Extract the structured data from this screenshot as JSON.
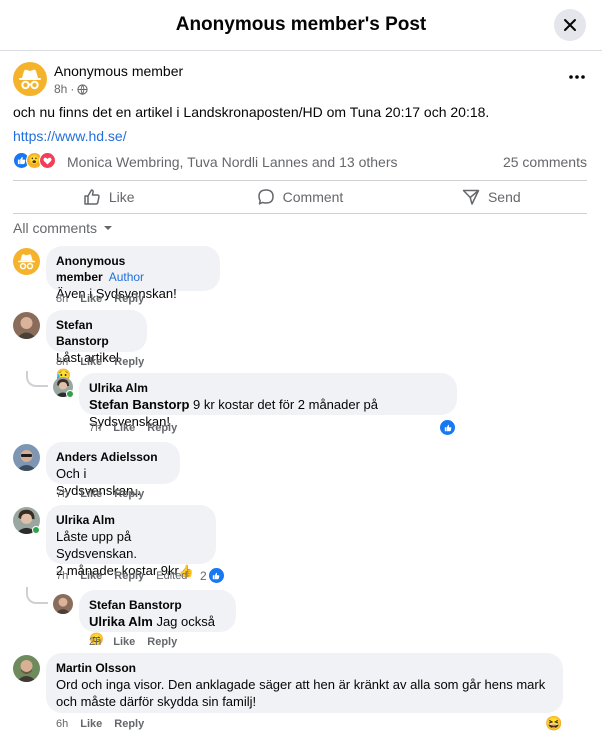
{
  "header": {
    "title": "Anonymous member's Post"
  },
  "post": {
    "author": "Anonymous member",
    "time": "8h",
    "text": "och nu finns det en artikel i Landskronaposten/HD om Tuna 20:17 och 20:18.",
    "link": "https://www.hd.se/",
    "reactions_text": "Monica Wembring, Tuva Nordli Lannes and 13 others",
    "comments_count": "25 comments"
  },
  "actions": {
    "like": "Like",
    "comment": "Comment",
    "send": "Send"
  },
  "filter": {
    "label": "All comments"
  },
  "comments": [
    {
      "name": "Anonymous member",
      "badge": "Author",
      "text": "Även i Sydsvenskan!",
      "time": "8h",
      "like": "Like",
      "reply": "Reply"
    },
    {
      "name": "Stefan Banstorp",
      "text": "Låst artikel",
      "emoji": "😥",
      "time": "8h",
      "like": "Like",
      "reply": "Reply"
    },
    {
      "name": "Ulrika Alm",
      "mention": "Stefan Banstorp",
      "text": " 9 kr kostar det för 2 månader på Sydsvenskan!",
      "time": "7h",
      "like": "Like",
      "reply": "Reply"
    },
    {
      "name": "Anders Adielsson",
      "text": "Och i Sydsvenskan...",
      "time": "7h",
      "like": "Like",
      "reply": "Reply"
    },
    {
      "name": "Ulrika Alm",
      "text1": "Låste upp på Sydsvenskan.",
      "text2": "2 månader kostar 9kr",
      "emoji": "👍",
      "time": "7h",
      "like": "Like",
      "reply": "Reply",
      "edited": "Edited",
      "reaction_count": "2"
    },
    {
      "name": "Stefan Banstorp",
      "mention": "Ulrika Alm",
      "text": " Jag också",
      "emoji": "😊",
      "time": "2h",
      "like": "Like",
      "reply": "Reply"
    },
    {
      "name": "Martin Olsson",
      "text1": "Ord och inga visor. Den anklagade säger att hen är kränkt av alla som går hens mark",
      "text2": "och måste därför skydda sin familj!",
      "time": "6h",
      "like": "Like",
      "reply": "Reply",
      "emoji": "😆"
    }
  ],
  "colors": {
    "accent": "#1877f2",
    "link": "#216fdb",
    "bubble": "#f0f2f5",
    "anon_avatar": "#f5b32b"
  }
}
